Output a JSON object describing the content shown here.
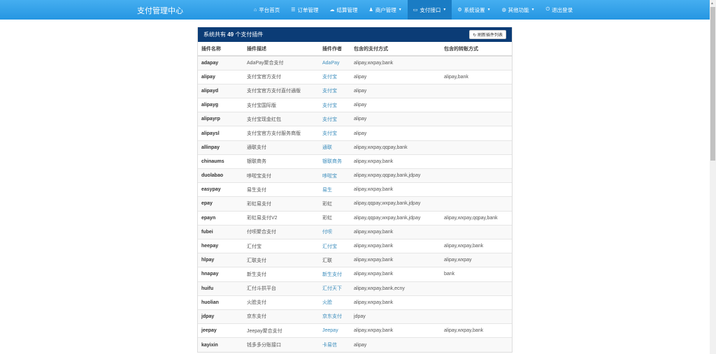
{
  "nav": {
    "brand": "支付管理中心",
    "items": [
      {
        "label": "平台首页",
        "icon": "home-icon",
        "glyph": "⌂",
        "dropdown": false
      },
      {
        "label": "订单管理",
        "icon": "list-icon",
        "glyph": "☰",
        "dropdown": false
      },
      {
        "label": "结算管理",
        "icon": "cloud-icon",
        "glyph": "☁",
        "dropdown": false
      },
      {
        "label": "商户管理",
        "icon": "user-icon",
        "glyph": "♟",
        "dropdown": true
      },
      {
        "label": "支付接口",
        "icon": "credit-card-icon",
        "glyph": "▭",
        "dropdown": true,
        "active": true
      },
      {
        "label": "系统设置",
        "icon": "gear-icon",
        "glyph": "⚙",
        "dropdown": true
      },
      {
        "label": "其他功能",
        "icon": "globe-icon",
        "glyph": "◍",
        "dropdown": true
      },
      {
        "label": "退出登录",
        "icon": "power-icon",
        "glyph": "⏻",
        "dropdown": false
      }
    ]
  },
  "panel": {
    "title_pre": "系统共有",
    "count": "49",
    "title_post": "个支付插件",
    "refresh_label": "刷新插件列表"
  },
  "table": {
    "headers": [
      "插件名称",
      "插件描述",
      "插件作者",
      "包含的支付方式",
      "包含的转账方式"
    ],
    "rows": [
      [
        "adapay",
        "AdaPay聚合支付",
        "AdaPay",
        "alipay,wxpay,bank",
        "",
        true
      ],
      [
        "alipay",
        "支付宝官方支付",
        "支付宝",
        "alipay",
        "alipay,bank",
        true
      ],
      [
        "alipayd",
        "支付宝官方支付直付通版",
        "支付宝",
        "alipay",
        "",
        true
      ],
      [
        "alipayg",
        "支付宝国际版",
        "支付宝",
        "alipay",
        "",
        true
      ],
      [
        "alipayrp",
        "支付宝现金红包",
        "支付宝",
        "alipay",
        "",
        true
      ],
      [
        "alipaysl",
        "支付宝官方支付服务商版",
        "支付宝",
        "alipay",
        "",
        true
      ],
      [
        "allinpay",
        "通联支付",
        "通联",
        "alipay,wxpay,qqpay,bank",
        "",
        true
      ],
      [
        "chinaums",
        "银联商务",
        "银联商务",
        "alipay,wxpay,bank",
        "",
        true
      ],
      [
        "duolabao",
        "哆啦宝支付",
        "哆啦宝",
        "alipay,wxpay,qqpay,bank,jdpay",
        "",
        true
      ],
      [
        "easypay",
        "易生支付",
        "易生",
        "alipay,wxpay,bank",
        "",
        true
      ],
      [
        "epay",
        "彩虹易支付",
        "彩虹",
        "alipay,qqpay,wxpay,bank,jdpay",
        "",
        false
      ],
      [
        "epayn",
        "彩虹易支付V2",
        "彩虹",
        "alipay,qqpay,wxpay,bank,jdpay",
        "alipay,wxpay,qqpay,bank",
        false
      ],
      [
        "fubei",
        "付呗聚合支付",
        "付呗",
        "alipay,wxpay,bank",
        "",
        true
      ],
      [
        "heepay",
        "汇付宝",
        "汇付宝",
        "alipay,wxpay,bank",
        "alipay,wxpay,bank",
        true
      ],
      [
        "hlpay",
        "汇联支付",
        "汇联",
        "alipay,wxpay,bank",
        "alipay,wxpay",
        false
      ],
      [
        "hnapay",
        "新生支付",
        "新生支付",
        "alipay,wxpay,bank",
        "bank",
        true
      ],
      [
        "huifu",
        "汇付斗拱平台",
        "汇付天下",
        "alipay,wxpay,bank,ecny",
        "",
        true
      ],
      [
        "huolian",
        "火脸支付",
        "火脸",
        "alipay,wxpay,bank",
        "",
        true
      ],
      [
        "jdpay",
        "京东支付",
        "京东支付",
        "jdpay",
        "",
        true
      ],
      [
        "jeepay",
        "Jeepay聚合支付",
        "Jeepay",
        "alipay,wxpay,bank",
        "alipay,wxpay,bank",
        true
      ],
      [
        "kayixin",
        "钱多多分账接口",
        "卡易信",
        "alipay",
        "",
        true
      ]
    ]
  }
}
